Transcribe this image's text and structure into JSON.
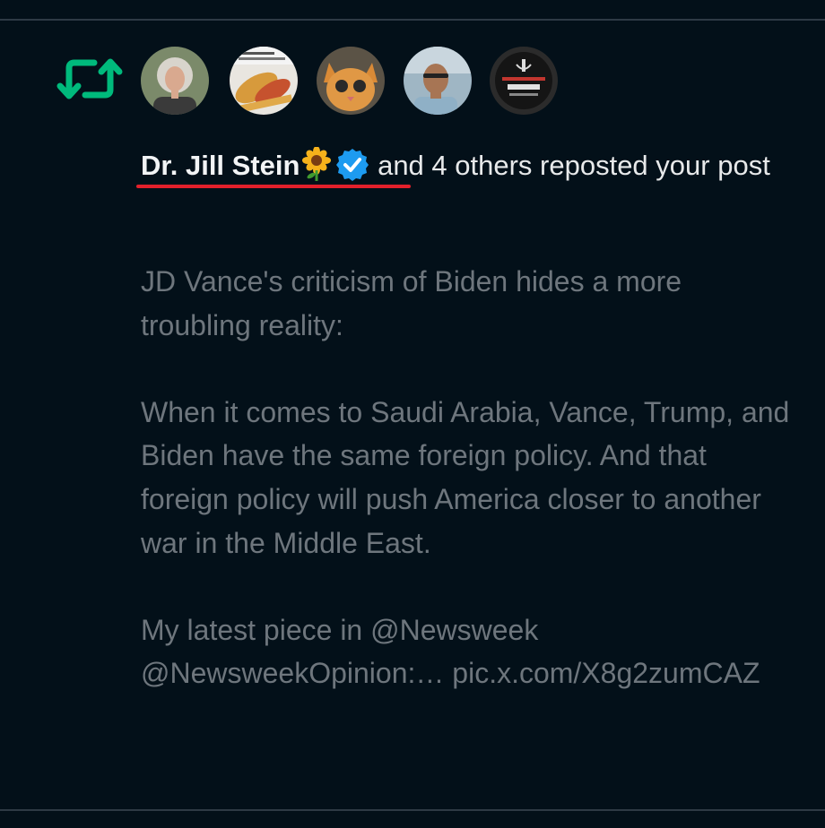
{
  "notification": {
    "type": "repost",
    "icon": "repost-icon",
    "accent_color": "#00ba7c",
    "avatars": [
      {
        "name": "avatar-jill-stein",
        "icon": "person-portrait"
      },
      {
        "name": "avatar-food",
        "icon": "food-photo"
      },
      {
        "name": "avatar-kitten",
        "icon": "kitten-photo"
      },
      {
        "name": "avatar-man",
        "icon": "person-portrait"
      },
      {
        "name": "avatar-amnesty",
        "icon": "candle-logo"
      }
    ],
    "user_name": "Dr. Jill Stein",
    "name_emoji": "sunflower-icon",
    "verified_icon": "verified-badge-icon",
    "verified_color": "#1d9bf0",
    "action_text": "and 4 others reposted your post",
    "underline_color": "#e3202b"
  },
  "post": {
    "paragraphs": [
      "JD Vance's criticism of Biden hides a more troubling reality:",
      "When it comes to Saudi Arabia, Vance, Trump, and Biden have the same foreign policy. And that foreign policy will push America closer to another war in the Middle East.",
      "My latest piece in @Newsweek @NewsweekOpinion:… pic.x.com/X8g2zumCAZ"
    ]
  }
}
